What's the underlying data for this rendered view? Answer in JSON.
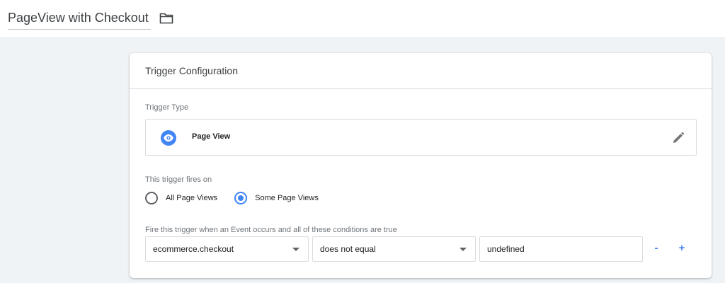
{
  "header": {
    "title": "PageView with Checkout",
    "folder_icon": "folder-icon"
  },
  "card": {
    "title": "Trigger Configuration",
    "trigger_type": {
      "label": "Trigger Type",
      "name": "Page View",
      "icon": "eye-icon",
      "edit_icon": "pencil-icon"
    },
    "fires_on": {
      "label": "This trigger fires on",
      "options": [
        {
          "label": "All Page Views",
          "selected": false
        },
        {
          "label": "Some Page Views",
          "selected": true
        }
      ]
    },
    "conditions": {
      "label": "Fire this trigger when an Event occurs and all of these conditions are true",
      "variable": "ecommerce.checkout",
      "operator": "does not equal",
      "value": "undefined",
      "remove_label": "-",
      "add_label": "+"
    }
  },
  "colors": {
    "accent": "#4285f4",
    "background": "#f0f3f6",
    "text": "#202124",
    "muted": "#6f7479",
    "border": "#dadce0"
  }
}
